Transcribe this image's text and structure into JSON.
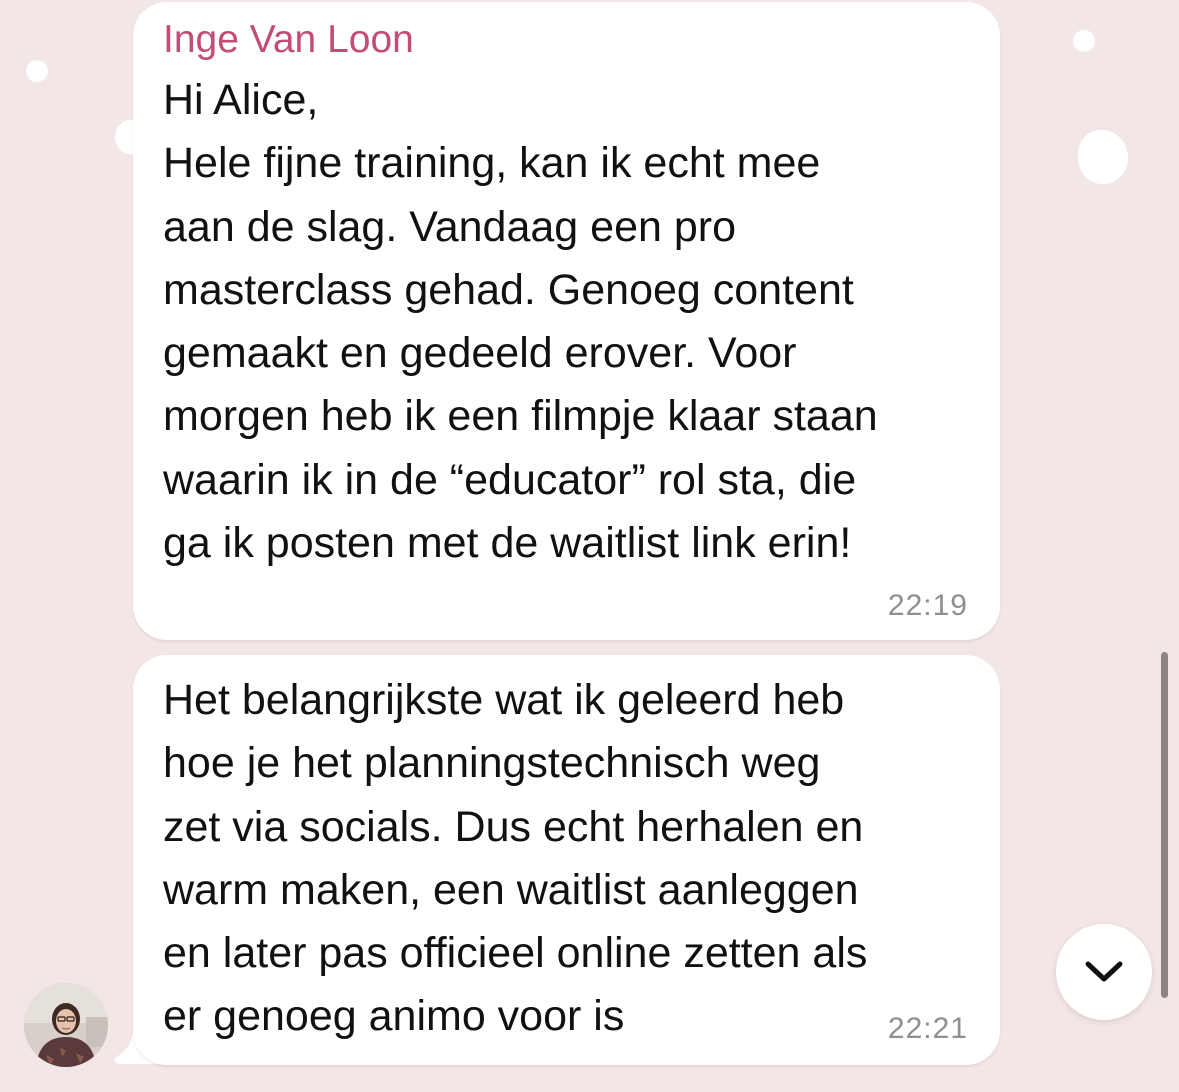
{
  "chat": {
    "messages": [
      {
        "sender": "Inge Van Loon",
        "lines": [
          "Hi Alice,",
          "Hele fijne training, kan ik echt mee",
          "aan de slag. Vandaag een pro",
          "masterclass gehad. Genoeg content",
          "gemaakt en gedeeld erover. Voor",
          "morgen heb ik een filmpje klaar staan",
          "waarin ik in de “educator” rol sta, die",
          "ga ik posten met de waitlist link erin!"
        ],
        "time": "22:19"
      },
      {
        "lines": [
          "Het belangrijkste wat ik geleerd heb",
          "hoe je het planningstechnisch weg",
          "zet via socials. Dus echt herhalen en",
          "warm maken, een waitlist aanleggen",
          "en later pas officieel online zetten als",
          "er genoeg animo voor is"
        ],
        "time": "22:21"
      }
    ]
  },
  "colors": {
    "background": "#f3e6e6",
    "bubble": "#ffffff",
    "sender_name": "#c14d78",
    "timestamp": "#8e8e93",
    "text": "#111111"
  },
  "icons": {
    "scroll_down": "chevron-down-icon",
    "avatar": "sender-avatar"
  }
}
